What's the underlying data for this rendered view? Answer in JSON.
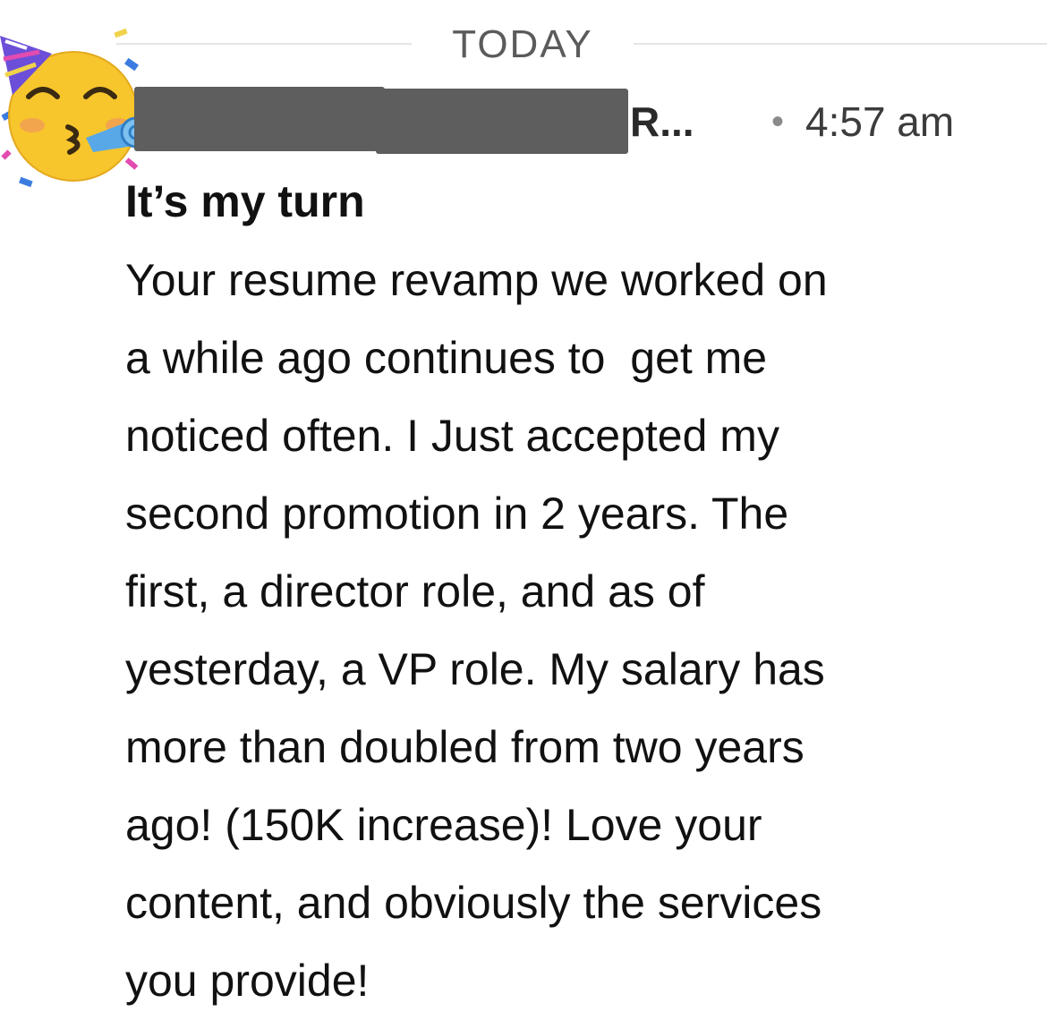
{
  "header": {
    "date_divider": "TODAY"
  },
  "message": {
    "avatar_icon": "partying-face-emoji-icon",
    "sender_visible_suffix": "R...",
    "separator": "•",
    "time": "4:57 am",
    "subject": "It’s my turn",
    "body_lines": [
      "Your resume revamp we worked on",
      "a while ago continues to  get me",
      "noticed often. I Just accepted my",
      "second promotion in 2 years. The",
      "first, a director role, and as of",
      "yesterday, a VP role. My salary has",
      "more than doubled from two years",
      "ago! (150K increase)! Love your",
      "content, and obviously the services",
      "you provide!"
    ]
  },
  "colors": {
    "redaction": "#5e5e5e",
    "divider": "#e4e4e4",
    "emoji_face": "#f7c52c"
  }
}
